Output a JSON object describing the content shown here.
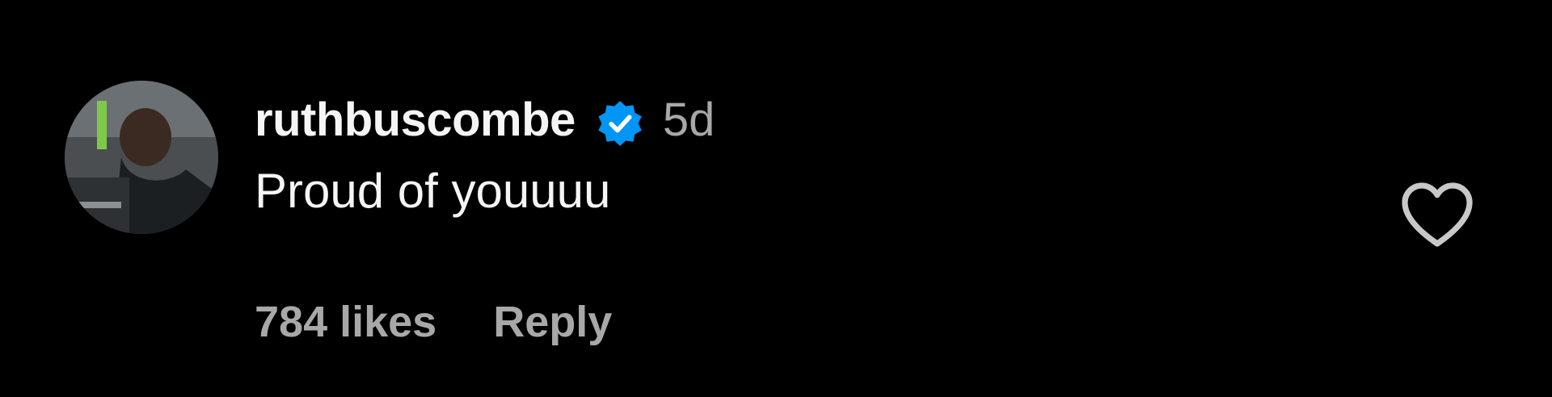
{
  "comment": {
    "username": "ruthbuscombe",
    "verified": true,
    "timestamp": "5d",
    "text": "Proud of youuuu",
    "likes_label": "784 likes",
    "reply_label": "Reply",
    "like_icon": "heart-outline-icon",
    "verified_icon": "verified-badge-icon",
    "avatar_icon": "profile-avatar"
  },
  "colors": {
    "background": "#000000",
    "primary_text": "#f5f5f5",
    "secondary_text": "#a8a8a8",
    "verified_blue": "#0095f6"
  }
}
